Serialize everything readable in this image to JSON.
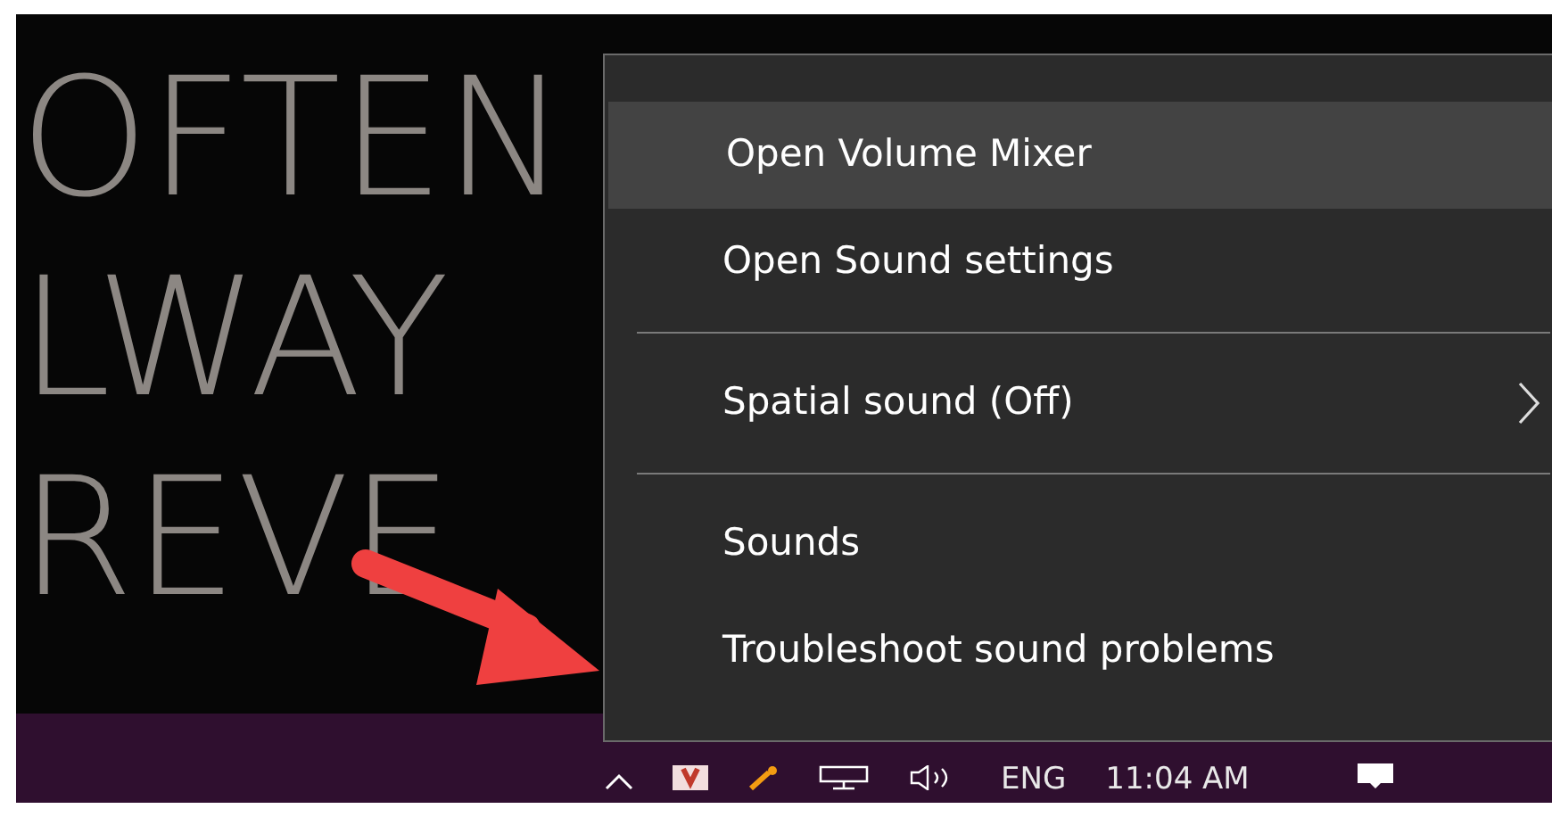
{
  "wallpaper": {
    "lines": [
      "OFTEN",
      "LWAY",
      "REVE"
    ]
  },
  "context_menu": {
    "items": [
      {
        "kind": "item",
        "label": "Open Volume Mixer",
        "highlighted": true,
        "submenu": false
      },
      {
        "kind": "item",
        "label": "Open Sound settings",
        "highlighted": false,
        "submenu": false
      },
      {
        "kind": "separator"
      },
      {
        "kind": "item",
        "label": "Spatial sound (Off)",
        "highlighted": false,
        "submenu": true
      },
      {
        "kind": "separator"
      },
      {
        "kind": "item",
        "label": "Sounds",
        "highlighted": false,
        "submenu": false
      },
      {
        "kind": "item",
        "label": "Troubleshoot sound problems",
        "highlighted": false,
        "submenu": false
      }
    ]
  },
  "taskbar": {
    "language": "ENG",
    "clock": "11:04 AM"
  }
}
